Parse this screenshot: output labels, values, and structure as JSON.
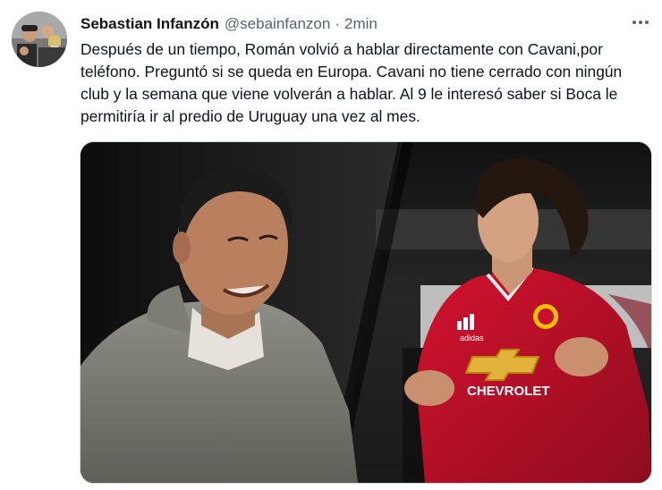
{
  "tweet": {
    "author_name": "Sebastian Infanzón",
    "handle": "@sebainfanzon",
    "separator": "·",
    "time": "2min",
    "text": "Después de un tiempo, Román volvió a hablar directamente con Cavani,por teléfono. Preguntó si se queda en Europa. Cavani no tiene cerrado con ningún club y la semana que viene volverán a hablar. Al 9 le interesó saber si Boca le permitiría ir al predio de Uruguay una vez al mes."
  },
  "media": {
    "jersey_sponsor": "CHEVROLET",
    "jersey_brand": "adidas"
  },
  "icons": {
    "more": "more-horizontal-icon"
  },
  "colors": {
    "text": "#0f1419",
    "secondary": "#536471",
    "jersey_red": "#c8102e"
  }
}
